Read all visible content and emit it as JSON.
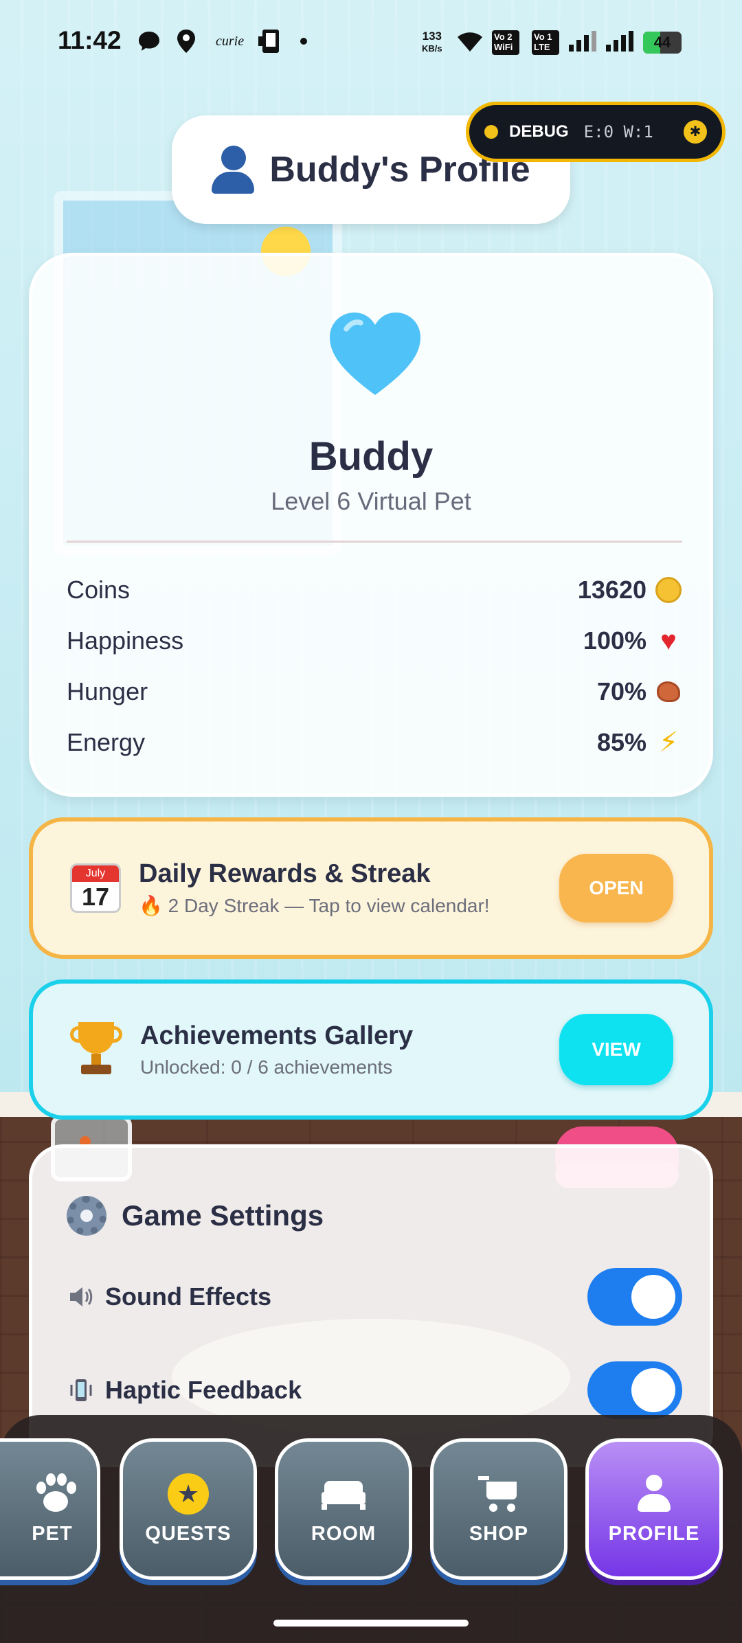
{
  "status_bar": {
    "time": "11:42",
    "carrier_text": "curie",
    "net_speed_value": "133",
    "net_speed_unit": "KB/s",
    "sim1_label_a": "Vo",
    "sim1_label_b": "WiFi",
    "sim1_num": "2",
    "sim2_label_a": "Vo",
    "sim2_label_b": "LTE",
    "sim2_num": "1",
    "battery_level": "44",
    "battery_fraction": 0.44
  },
  "debug": {
    "label": "DEBUG",
    "counts": "E:0 W:1"
  },
  "header": {
    "title": "Buddy's Profile"
  },
  "profile": {
    "pet_name": "Buddy",
    "subtitle": "Level 6 Virtual Pet",
    "stats": [
      {
        "label": "Coins",
        "value": "13620",
        "icon": "coin-icon"
      },
      {
        "label": "Happiness",
        "value": "100%",
        "icon": "red-heart-icon"
      },
      {
        "label": "Hunger",
        "value": "70%",
        "icon": "meat-icon"
      },
      {
        "label": "Energy",
        "value": "85%",
        "icon": "lightning-icon"
      }
    ]
  },
  "rewards": {
    "calendar_month": "July",
    "calendar_day": "17",
    "title": "Daily Rewards & Streak",
    "subtitle": "2 Day Streak — Tap to view calendar!",
    "button": "OPEN"
  },
  "achievements": {
    "title": "Achievements Gallery",
    "subtitle": "Unlocked: 0 / 6 achievements",
    "button": "VIEW"
  },
  "settings": {
    "title": "Game Settings",
    "items": [
      {
        "label": "Sound Effects",
        "enabled": true,
        "icon": "speaker-icon"
      },
      {
        "label": "Haptic Feedback",
        "enabled": true,
        "icon": "vibrate-phone-icon"
      }
    ]
  },
  "nav": {
    "items": [
      {
        "label": "PET",
        "icon": "paw-icon",
        "active": false
      },
      {
        "label": "QUESTS",
        "icon": "star-icon",
        "active": false
      },
      {
        "label": "ROOM",
        "icon": "bed-icon",
        "active": false
      },
      {
        "label": "SHOP",
        "icon": "cart-icon",
        "active": false
      },
      {
        "label": "PROFILE",
        "icon": "person-icon",
        "active": true
      }
    ]
  },
  "colors": {
    "accent_purple": "#7536e6",
    "rewards_border": "#f5b546",
    "achievements_border": "#1bd0ea",
    "toggle_on": "#1e7ef0",
    "heart_blue": "#4fc3f7"
  }
}
